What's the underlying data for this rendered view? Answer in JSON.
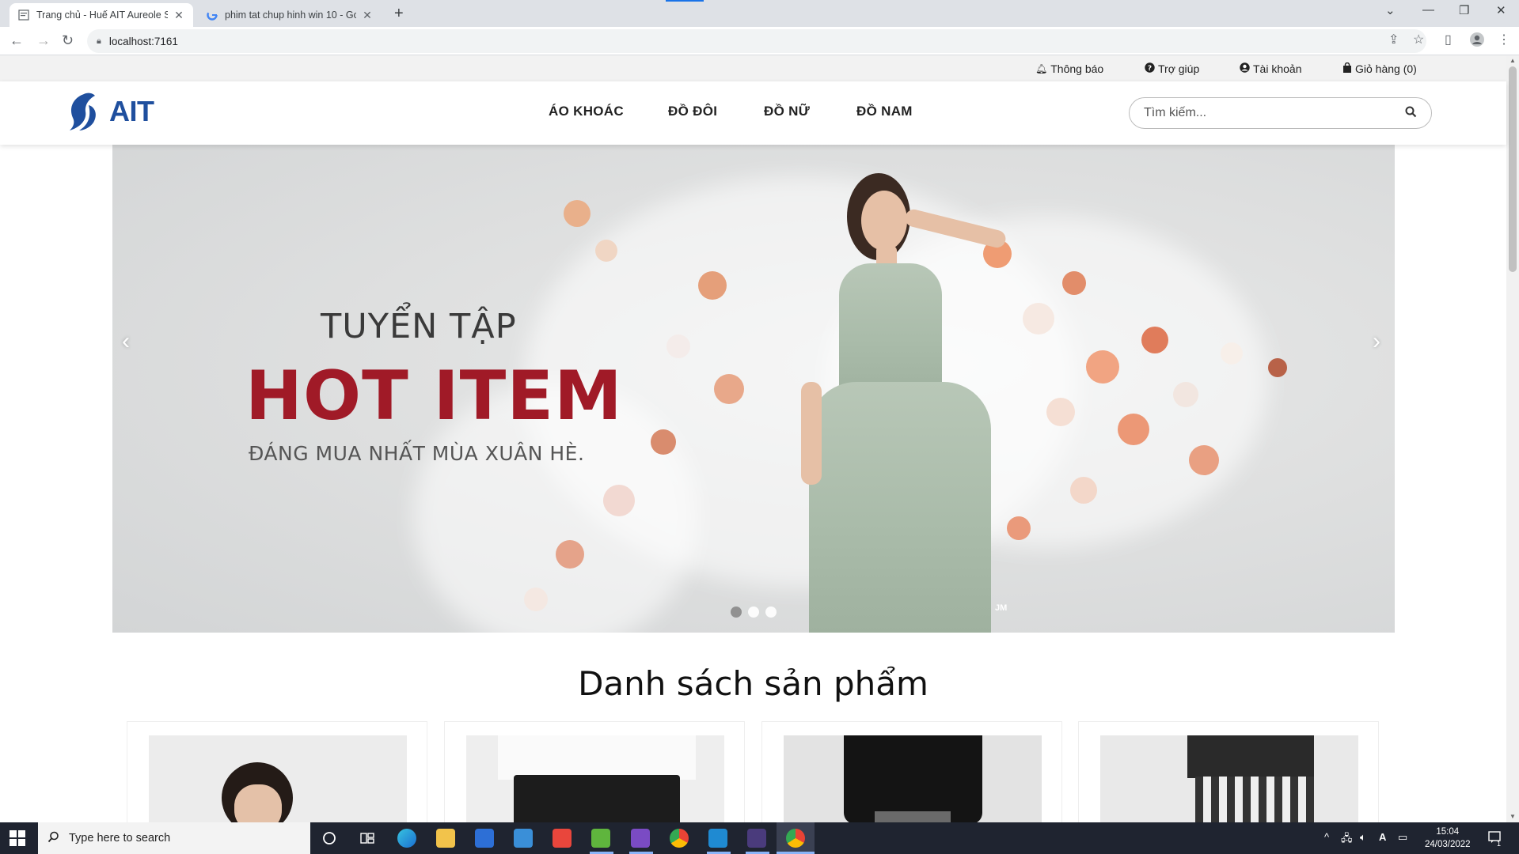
{
  "browser": {
    "tabs": [
      {
        "title": "Trang chủ - Huế AIT Aureole Sho",
        "active": true
      },
      {
        "title": "phim tat chup hinh win 10 - Goo",
        "active": false
      }
    ],
    "url": "localhost:7161"
  },
  "topbar": {
    "notifications": "Thông báo",
    "help": "Trợ giúp",
    "account": "Tài khoản",
    "cart": "Giỏ hàng (0)"
  },
  "header": {
    "logo_text": "AIT",
    "menu": [
      "ÁO KHOÁC",
      "ĐỒ ĐÔI",
      "ĐỒ NỮ",
      "ĐỒ NAM"
    ],
    "search_placeholder": "Tìm kiếm..."
  },
  "banner": {
    "line1": "TUYỂN TẬP",
    "line2": "HOT ITEM",
    "line3": "ĐÁNG MUA NHẤT MÙA XUÂN HÈ.",
    "watermark": "JM",
    "slides": 3,
    "active_slide": 1,
    "accent_color": "#a01a27"
  },
  "products": {
    "title": "Danh sách sản phẩm",
    "items": [
      {
        "image": "model-white-shirt"
      },
      {
        "image": "white-tee-black-pants"
      },
      {
        "image": "black-shirt"
      },
      {
        "image": "plaid-shorts"
      }
    ]
  },
  "taskbar": {
    "search_placeholder": "Type here to search",
    "time": "15:04",
    "date": "24/03/2022",
    "notification_count": "1",
    "lang": "A"
  }
}
